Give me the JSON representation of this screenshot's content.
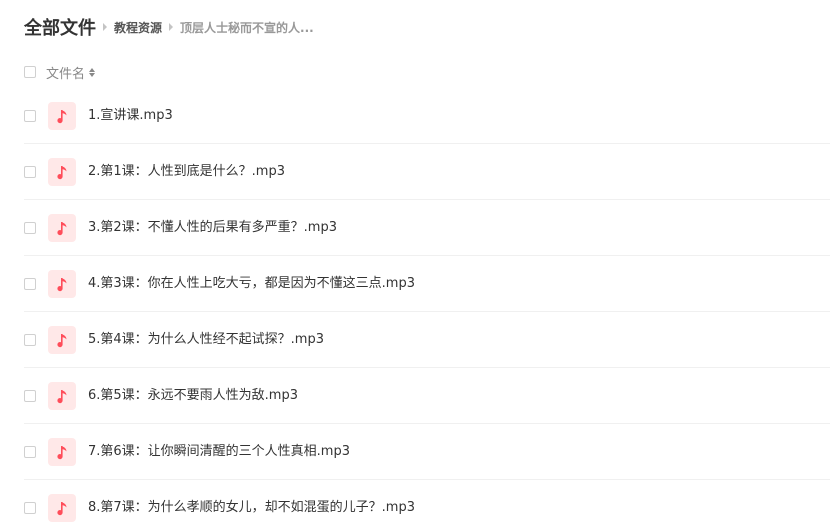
{
  "header": {
    "title": "全部文件",
    "breadcrumbs": [
      "教程资源",
      "顶层人士秘而不宣的人..."
    ]
  },
  "column_header": {
    "name_label": "文件名"
  },
  "colors": {
    "file_icon_bg": "#ffe8e8",
    "file_icon_fg": "#ff4d5a"
  },
  "files": [
    {
      "name": "1.宣讲课.mp3",
      "icon": "music-note-icon"
    },
    {
      "name": "2.第1课：人性到底是什么？.mp3",
      "icon": "music-note-icon"
    },
    {
      "name": "3.第2课：不懂人性的后果有多严重？.mp3",
      "icon": "music-note-icon"
    },
    {
      "name": "4.第3课：你在人性上吃大亏，都是因为不懂这三点.mp3",
      "icon": "music-note-icon"
    },
    {
      "name": "5.第4课：为什么人性经不起试探？.mp3",
      "icon": "music-note-icon"
    },
    {
      "name": "6.第5课：永远不要雨人性为敌.mp3",
      "icon": "music-note-icon"
    },
    {
      "name": "7.第6课：让你瞬间清醒的三个人性真相.mp3",
      "icon": "music-note-icon"
    },
    {
      "name": "8.第7课：为什么孝顺的女儿，却不如混蛋的儿子？.mp3",
      "icon": "music-note-icon"
    }
  ]
}
